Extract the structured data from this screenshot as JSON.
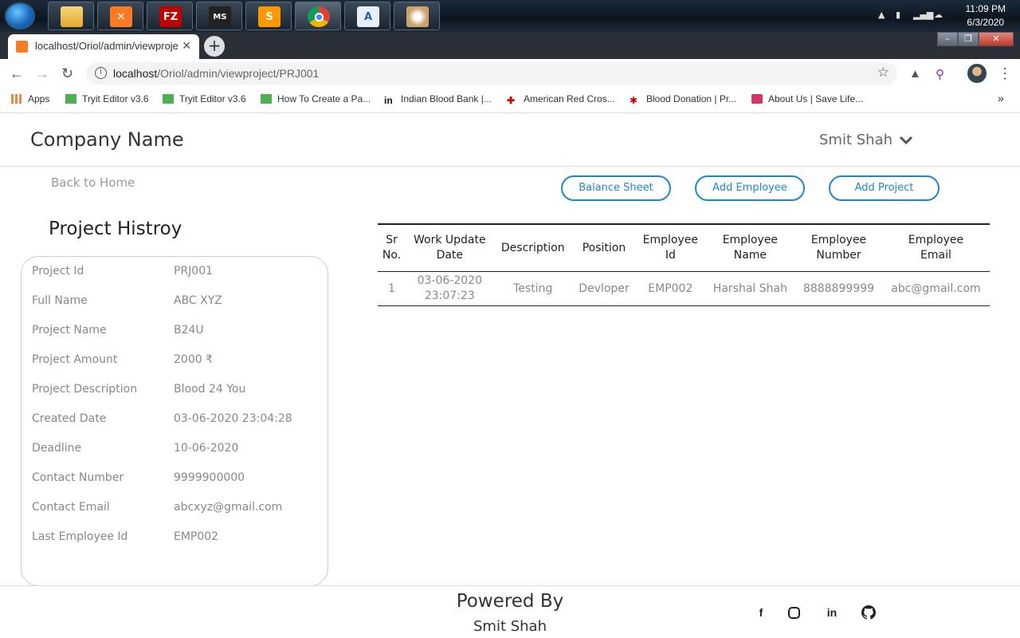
{
  "taskbar": {
    "apps": [
      "explorer",
      "xampp",
      "filezilla",
      "ms-tc",
      "sublime-text",
      "chrome",
      "wordpad",
      "paint"
    ],
    "time": "11:09 PM",
    "date": "6/3/2020"
  },
  "browser": {
    "tab_title": "localhost/Oriol/admin/viewproje",
    "url_host": "localhost",
    "url_path": "/Oriol/admin/viewproject/PRJ001",
    "bookmarks": [
      "Apps",
      "Tryit Editor v3.6",
      "Tryit Editor v3.6",
      "How To Create a Pa...",
      "Indian Blood Bank |...",
      "American Red Cros...",
      "Blood Donation | Pr...",
      "About Us | Save Life..."
    ],
    "more": "»"
  },
  "header": {
    "company": "Company Name",
    "user": "Smit Shah"
  },
  "nav": {
    "back": "Back to Home",
    "buttons": [
      "Balance Sheet",
      "Add Employee",
      "Add Project"
    ]
  },
  "project": {
    "title": "Project Histroy",
    "fields": [
      {
        "label": "Project Id",
        "value": "PRJ001"
      },
      {
        "label": "Full Name",
        "value": "ABC XYZ"
      },
      {
        "label": "Project Name",
        "value": "B24U"
      },
      {
        "label": "Project Amount",
        "value": "2000 ₹"
      },
      {
        "label": "Project Description",
        "value": "Blood 24 You"
      },
      {
        "label": "Created Date",
        "value": "03-06-2020 23:04:28"
      },
      {
        "label": "Deadline",
        "value": "10-06-2020"
      },
      {
        "label": "Contact Number",
        "value": "9999900000"
      },
      {
        "label": "Contact Email",
        "value": "abcxyz@gmail.com"
      },
      {
        "label": "Last Employee Id",
        "value": "EMP002"
      }
    ]
  },
  "table": {
    "headers": [
      [
        "Sr",
        "No."
      ],
      [
        "Work Update",
        "Date"
      ],
      [
        "Description"
      ],
      [
        "Position"
      ],
      [
        "Employee",
        "Id"
      ],
      [
        "Employee",
        "Name"
      ],
      [
        "Employee",
        "Number"
      ],
      [
        "Employee",
        "Email"
      ]
    ],
    "rows": [
      [
        [
          "1"
        ],
        [
          "03-06-2020",
          "23:07:23"
        ],
        [
          "Testing"
        ],
        [
          "Devloper"
        ],
        [
          "EMP002"
        ],
        [
          "Harshal Shah"
        ],
        [
          "8888899999"
        ],
        [
          "abc@gmail.com"
        ]
      ]
    ]
  },
  "footer": {
    "powered": "Powered By",
    "author": "Smit Shah",
    "social": [
      "f",
      "instagram",
      "in",
      "github"
    ]
  }
}
